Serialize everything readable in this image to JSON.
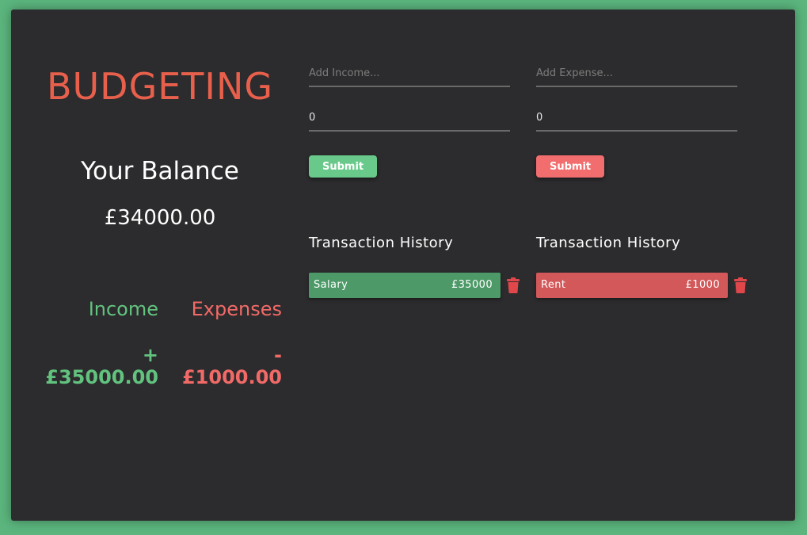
{
  "app": {
    "title": "BUDGETING",
    "balance_label": "Your Balance",
    "balance_value": "£34000.00"
  },
  "summary": {
    "income_label": "Income",
    "income_value": "+£35000.00",
    "expense_label": "Expenses",
    "expense_value": "-£1000.00"
  },
  "income_form": {
    "text_placeholder": "Add Income...",
    "amount_value": "0",
    "submit_label": "Submit"
  },
  "expense_form": {
    "text_placeholder": "Add Expense...",
    "amount_value": "0",
    "submit_label": "Submit"
  },
  "income_history": {
    "title": "Transaction History",
    "items": [
      {
        "name": "Salary",
        "amount": "£35000"
      }
    ]
  },
  "expense_history": {
    "title": "Transaction History",
    "items": [
      {
        "name": "Rent",
        "amount": "£1000"
      }
    ]
  },
  "colors": {
    "background": "#5bb57d",
    "panel": "#2c2c2e",
    "title": "#e8604c",
    "income": "#62c37f",
    "expense": "#f26a67",
    "income_bar": "#4d9a68",
    "expense_bar": "#d2585a",
    "trash": "#e0474a"
  },
  "icons": {
    "delete": "trash-icon"
  }
}
